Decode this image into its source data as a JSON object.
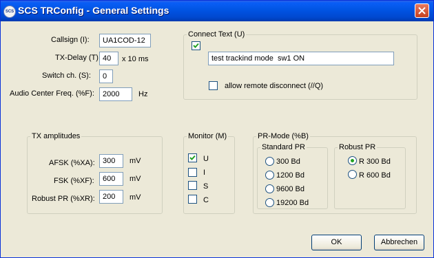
{
  "window": {
    "title": "SCS TRConfig - General Settings",
    "app_icon_text": "SCS"
  },
  "general": {
    "callsign_label": "Callsign (I):",
    "callsign_value": "UA1COD-12",
    "txdelay_label": "TX-Delay (T):",
    "txdelay_value": "40",
    "txdelay_unit": "x 10 ms",
    "switch_label": "Switch ch. (S):",
    "switch_value": "0",
    "audio_label": "Audio Center Freq. (%F):",
    "audio_value": "2000",
    "audio_unit": "Hz"
  },
  "connect_text": {
    "legend": "Connect Text (U)",
    "enabled": true,
    "text_value": "test trackind mode  sw1 ON",
    "remote_disconnect_label": "allow remote disconnect (//Q)",
    "remote_disconnect_checked": false
  },
  "tx_amplitudes": {
    "legend": "TX amplitudes",
    "afsk_label": "AFSK (%XA):",
    "afsk_value": "300",
    "afsk_unit": "mV",
    "fsk_label": "FSK (%XF):",
    "fsk_value": "600",
    "fsk_unit": "mV",
    "robust_label": "Robust PR (%XR):",
    "robust_value": "200",
    "robust_unit": "mV"
  },
  "monitor": {
    "legend": "Monitor (M)",
    "items": [
      {
        "label": "U",
        "checked": true
      },
      {
        "label": "I",
        "checked": false
      },
      {
        "label": "S",
        "checked": false
      },
      {
        "label": "C",
        "checked": false
      }
    ]
  },
  "pr_mode": {
    "legend": "PR-Mode (%B)",
    "standard": {
      "legend": "Standard PR",
      "options": [
        "300 Bd",
        "1200 Bd",
        "9600 Bd",
        "19200 Bd"
      ],
      "selected_index": -1
    },
    "robust": {
      "legend": "Robust PR",
      "options": [
        "R 300 Bd",
        "R 600 Bd"
      ],
      "selected_index": 0
    }
  },
  "buttons": {
    "ok": "OK",
    "cancel": "Abbrechen"
  },
  "colors": {
    "title_bar": "#0054e3",
    "dialog_bg": "#ece9d8",
    "close_button": "#c5401e",
    "check_mark": "#21a121"
  }
}
